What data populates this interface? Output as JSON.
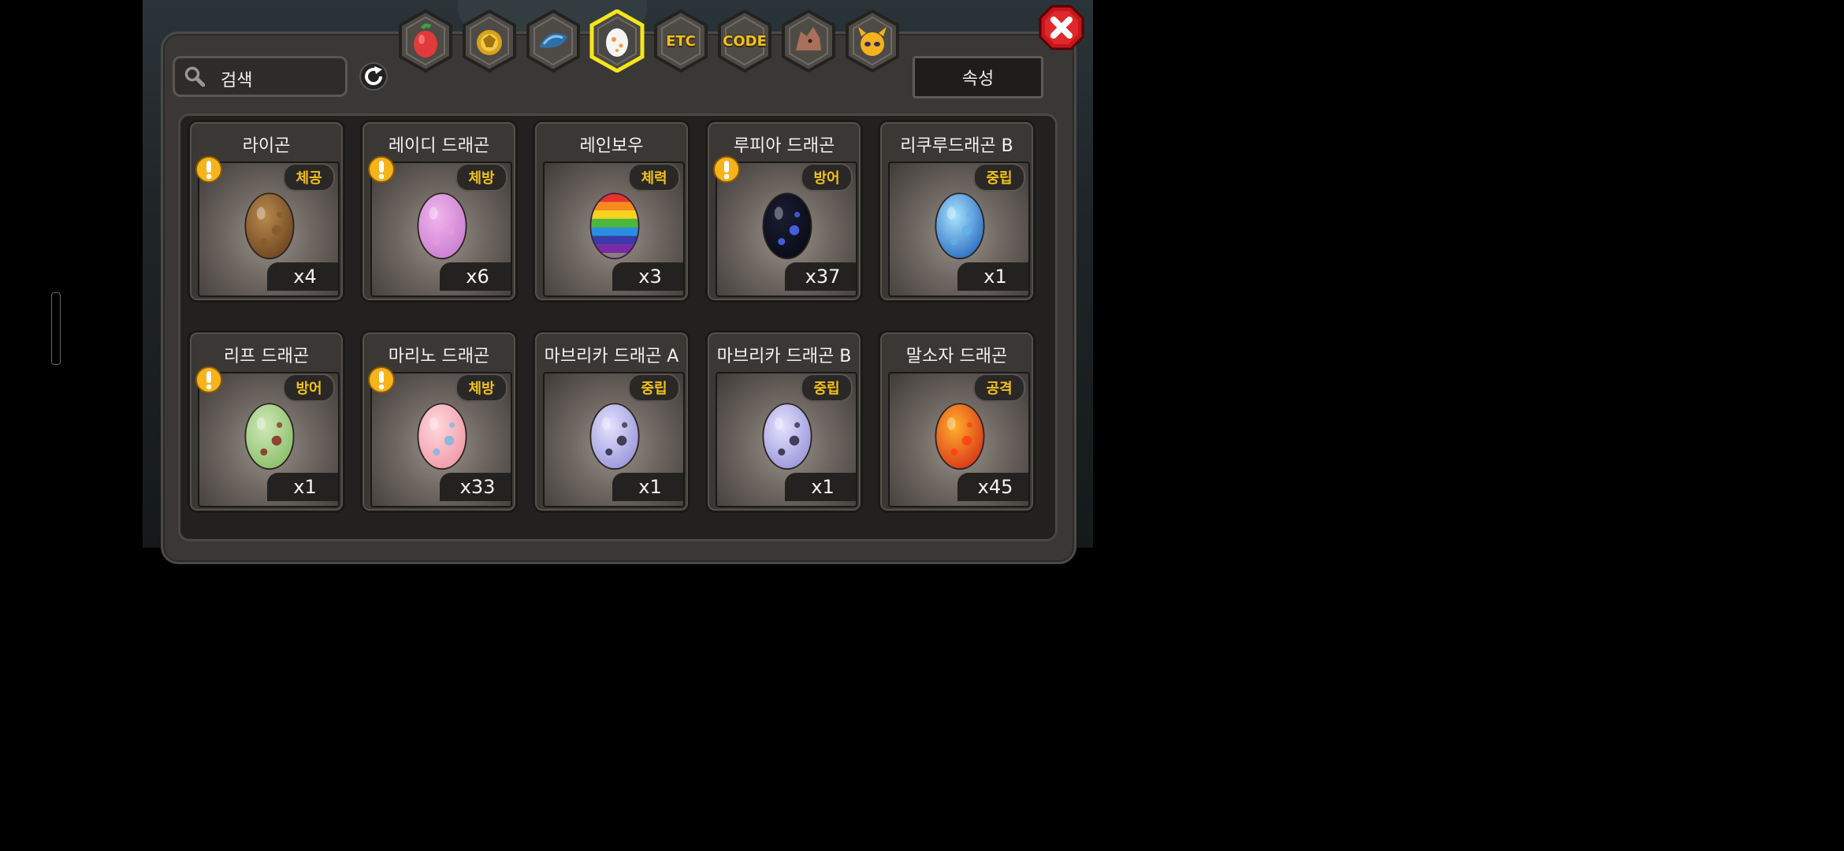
{
  "search": {
    "placeholder": "검색"
  },
  "attribute_button": "속성",
  "tabs": [
    {
      "name": "fruit",
      "label": "",
      "icon": "fruit-icon"
    },
    {
      "name": "gold",
      "label": "",
      "icon": "gold-icon"
    },
    {
      "name": "creature",
      "label": "",
      "icon": "creature-icon"
    },
    {
      "name": "egg",
      "label": "",
      "icon": "egg-icon",
      "selected": true
    },
    {
      "name": "etc",
      "label": "ETC",
      "icon": ""
    },
    {
      "name": "code",
      "label": "CODE",
      "icon": ""
    },
    {
      "name": "dragon",
      "label": "",
      "icon": "dragon-icon"
    },
    {
      "name": "spirit",
      "label": "",
      "icon": "spirit-icon"
    }
  ],
  "eggs": [
    {
      "name": "라이곤",
      "attr": "체공",
      "count": "x4",
      "alert": true,
      "colors": [
        "#b98a4e",
        "#6e4520",
        "#8a5a2a"
      ]
    },
    {
      "name": "레이디 드래곤",
      "attr": "체방",
      "count": "x6",
      "alert": true,
      "colors": [
        "#f2b4ee",
        "#c97fd0",
        "#e79ad9"
      ]
    },
    {
      "name": "레인보우",
      "attr": "체력",
      "count": "x3",
      "alert": false,
      "colors": [
        "rainbow"
      ]
    },
    {
      "name": "루피아 드래곤",
      "attr": "방어",
      "count": "x37",
      "alert": true,
      "colors": [
        "#1a1c33",
        "#0a0b16",
        "#4d6bff"
      ]
    },
    {
      "name": "리쿠루드래곤 B",
      "attr": "중립",
      "count": "x1",
      "alert": false,
      "colors": [
        "#a8e3ff",
        "#2c6fc2",
        "#5fb1e8"
      ]
    },
    {
      "name": "리프 드래곤",
      "attr": "방어",
      "count": "x1",
      "alert": true,
      "colors": [
        "#cfe8b8",
        "#8bbf6a",
        "#8a2a20"
      ]
    },
    {
      "name": "마리노 드래곤",
      "attr": "체방",
      "count": "x33",
      "alert": true,
      "colors": [
        "#ffd8dc",
        "#f19aa8",
        "#7fb6e0"
      ]
    },
    {
      "name": "마브리카 드래곤 A",
      "attr": "중립",
      "count": "x1",
      "alert": false,
      "colors": [
        "#e4e2ff",
        "#9a97d8",
        "#2a2840"
      ]
    },
    {
      "name": "마브리카 드래곤 B",
      "attr": "중립",
      "count": "x1",
      "alert": false,
      "colors": [
        "#e4e2ff",
        "#9a97d8",
        "#2a2840"
      ]
    },
    {
      "name": "말소자 드래곤",
      "attr": "공격",
      "count": "x45",
      "alert": false,
      "colors": [
        "#ffb02a",
        "#d9361a",
        "#ff4010"
      ]
    }
  ]
}
